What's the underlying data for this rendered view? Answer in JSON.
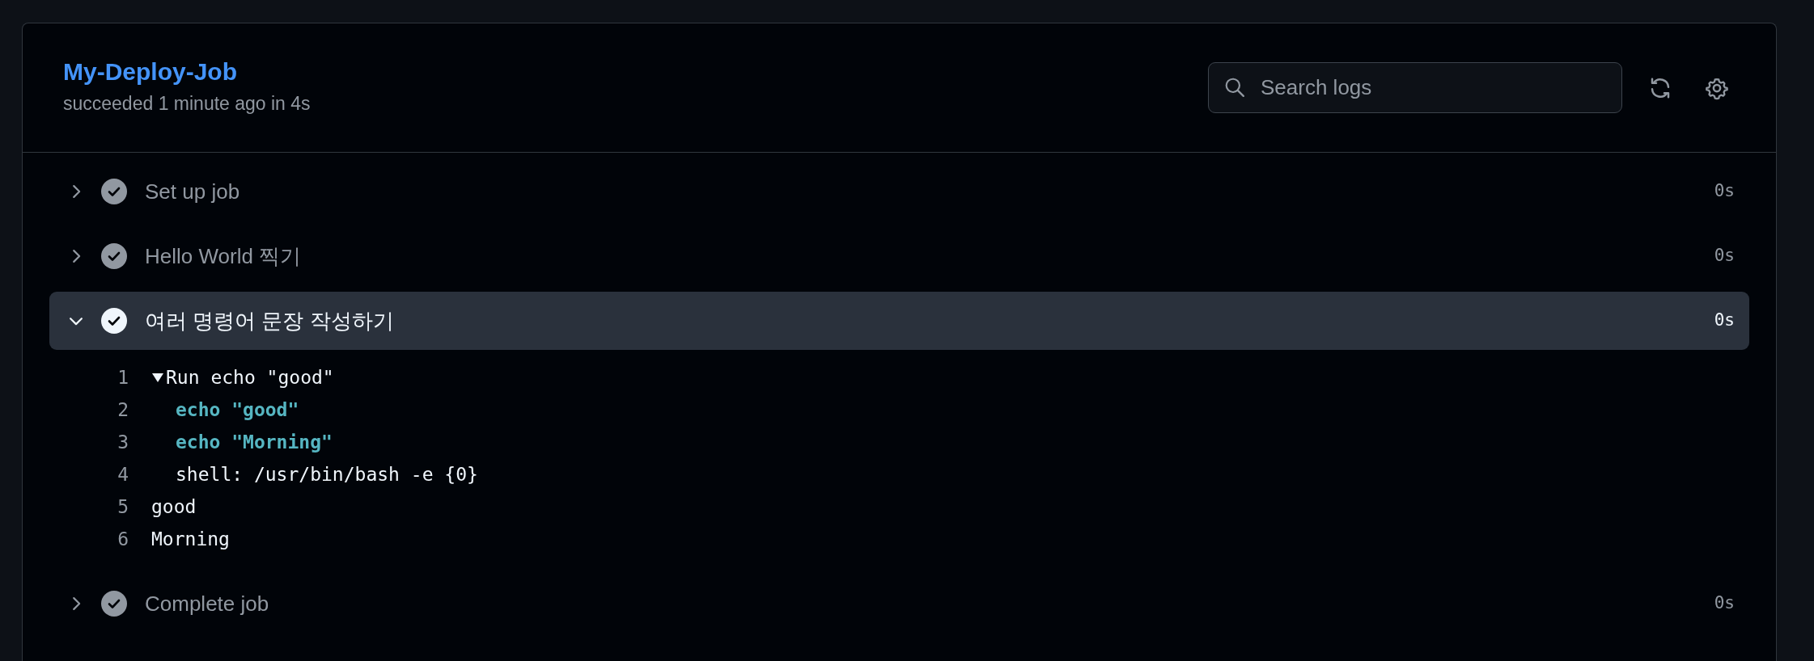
{
  "job": {
    "title": "My-Deploy-Job",
    "subtitle": "succeeded 1 minute ago in 4s"
  },
  "search": {
    "placeholder": "Search logs"
  },
  "steps": [
    {
      "name": "Set up job",
      "duration": "0s",
      "expanded": false
    },
    {
      "name": "Hello World 찍기",
      "duration": "0s",
      "expanded": false
    },
    {
      "name": "여러 명령어 문장 작성하기",
      "duration": "0s",
      "expanded": true,
      "log": [
        {
          "number": "1",
          "kind": "group",
          "text": "Run echo \"good\"",
          "expanded": true,
          "children": [
            {
              "number": "2",
              "kind": "command",
              "text": "echo \"good\""
            },
            {
              "number": "3",
              "kind": "command",
              "text": "echo \"Morning\""
            },
            {
              "number": "4",
              "kind": "plain",
              "text": "shell: /usr/bin/bash -e {0}"
            }
          ]
        },
        {
          "number": "5",
          "kind": "plain",
          "text": "good"
        },
        {
          "number": "6",
          "kind": "plain",
          "text": "Morning"
        }
      ]
    },
    {
      "name": "Complete job",
      "duration": "0s",
      "expanded": false
    }
  ]
}
